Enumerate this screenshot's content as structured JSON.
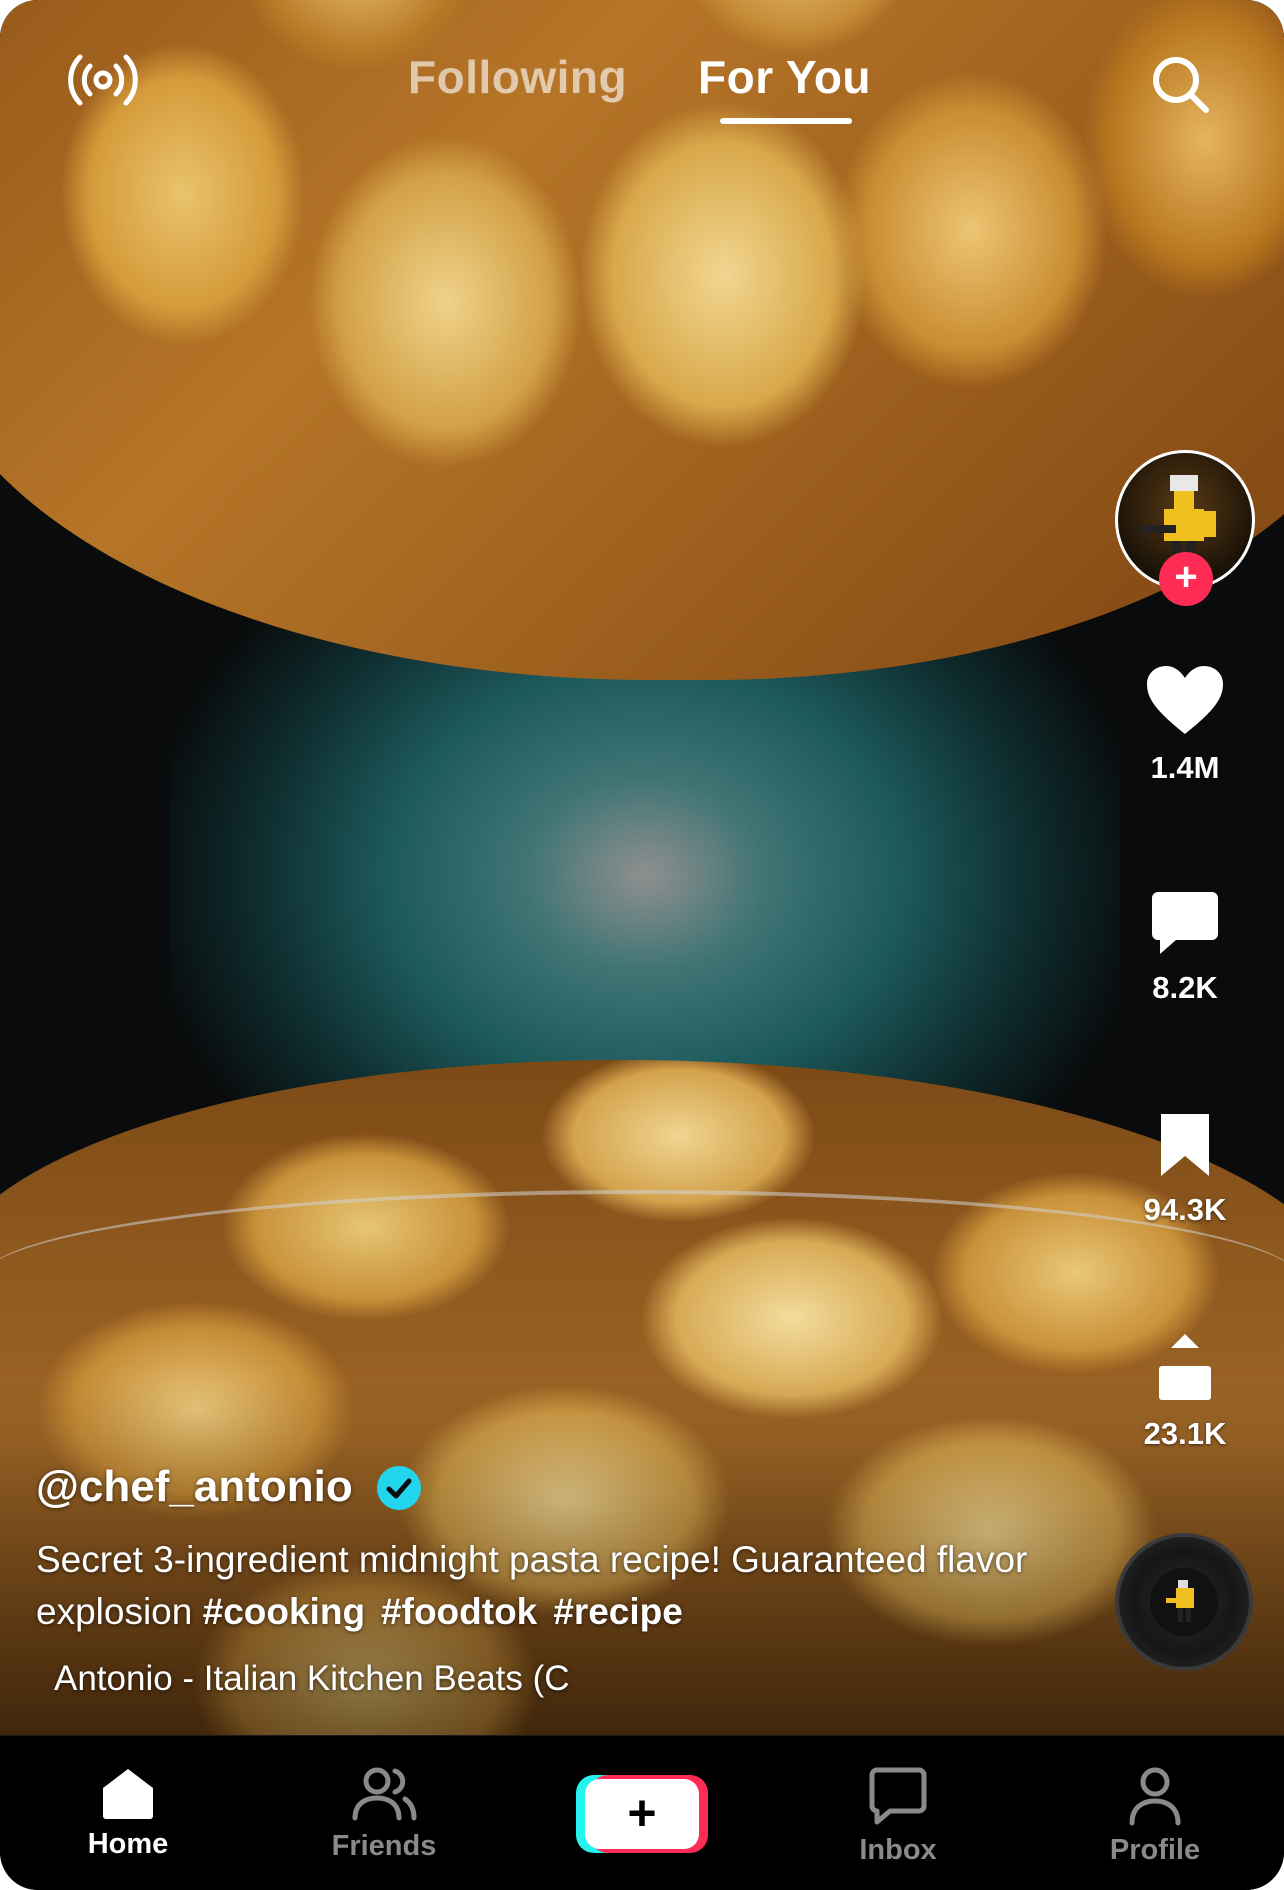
{
  "top_bar": {
    "tabs": [
      {
        "label": "Following",
        "active": false
      },
      {
        "label": "For You",
        "active": true
      }
    ]
  },
  "creator": {
    "username": "@chef_antonio",
    "verified": true
  },
  "caption": {
    "text": "Secret 3-ingredient midnight pasta recipe! Guaranteed flavor explosion",
    "hashtags": [
      "#cooking",
      "#foodtok",
      "#recipe"
    ]
  },
  "sound": {
    "label": "Antonio - Italian Kitchen Beats (C"
  },
  "actions": {
    "likes": "1.4M",
    "comments": "8.2K",
    "saves": "94.3K",
    "shares": "23.1K"
  },
  "follow_button_label": "+",
  "bottom_nav": {
    "home": "Home",
    "friends": "Friends",
    "create": "+",
    "inbox": "Inbox",
    "profile": "Profile"
  },
  "colors": {
    "accent_red": "#fe2c55",
    "accent_cyan": "#25f4ee",
    "verified_badge": "#20d5ec"
  }
}
